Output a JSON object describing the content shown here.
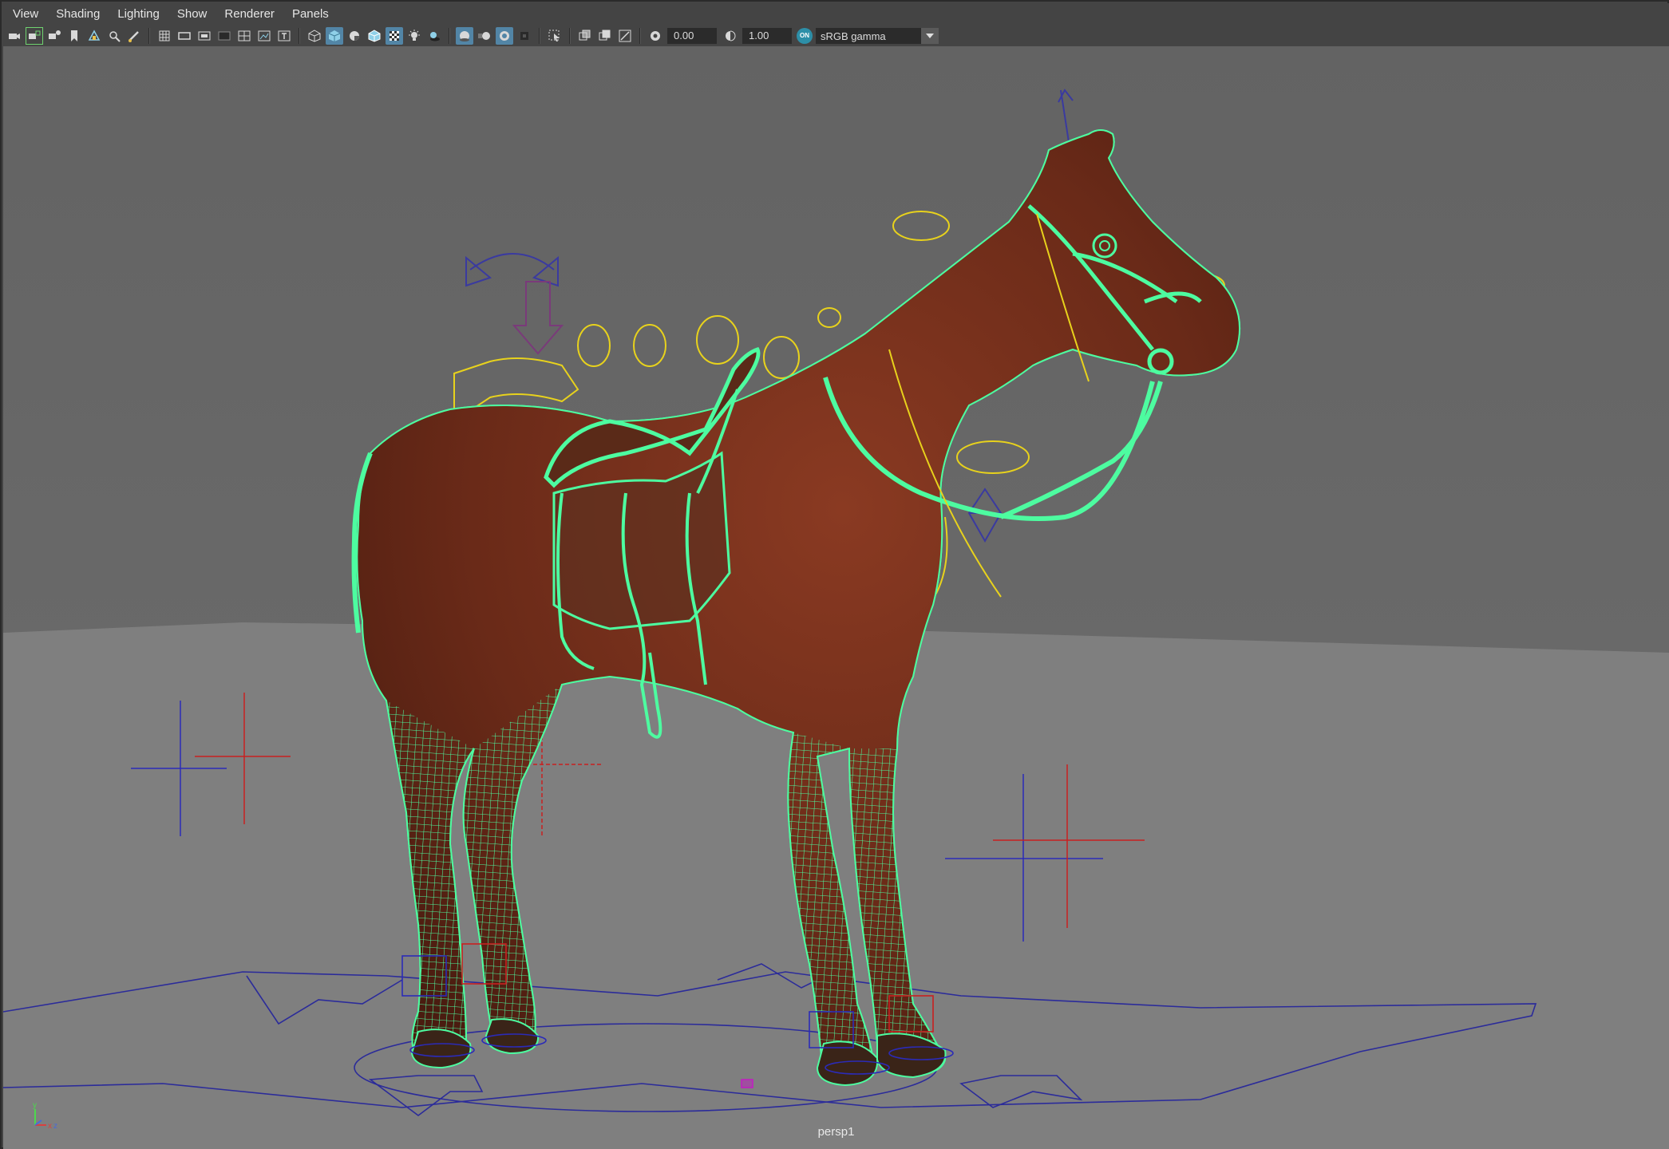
{
  "menu": [
    "View",
    "Shading",
    "Lighting",
    "Show",
    "Renderer",
    "Panels"
  ],
  "toolbar": {
    "group1": [
      "camera-icon",
      "camera-lock-icon",
      "camera-attributes-icon",
      "bookmark-icon",
      "image-plane-icon",
      "2d-pan-zoom-icon",
      "grease-pencil-icon"
    ],
    "group2": [
      "grid-icon",
      "film-gate-icon",
      "resolution-gate-icon",
      "gate-mask-icon",
      "field-chart-icon",
      "safe-action-icon",
      "safe-title-icon"
    ],
    "group3": [
      "wireframe-icon",
      "smooth-shade-icon",
      "default-material-icon",
      "wireframe-on-shaded-icon",
      "textured-icon",
      "use-lights-icon",
      "shadows-icon"
    ],
    "group4": [
      "screen-space-ao-icon",
      "motion-blur-icon",
      "multisample-aa-icon",
      "depth-of-field-icon"
    ],
    "group5": [
      "isolate-select-icon"
    ],
    "group6": [
      "xray-icon",
      "xray-active-icon",
      "xray-joints-icon"
    ],
    "exposure_icon": "exposure-icon",
    "exposure_value": "0.00",
    "gamma_icon": "gamma-icon",
    "gamma_value": "1.00",
    "color_mgmt_badge": "ON",
    "color_space": "sRGB gamma"
  },
  "viewport": {
    "camera_name": "persp1",
    "axis": {
      "x": "x",
      "y": "y",
      "z": "z"
    }
  },
  "colors": {
    "background_top": "#6b6b6b",
    "ground": "#808080",
    "wireframe": "#4dfca0",
    "horse_coat": "#6e2e1c",
    "control_yellow": "#e8d21c",
    "control_blue": "#2b2bb8",
    "control_red": "#c82020"
  }
}
